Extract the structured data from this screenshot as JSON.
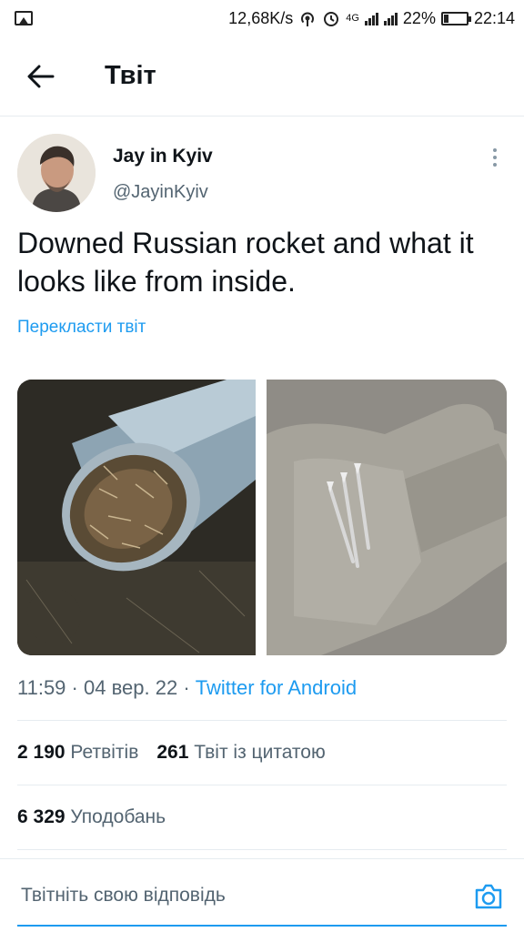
{
  "status_bar": {
    "network_speed": "12,68K/s",
    "network_type": "4G",
    "battery_percent": "22%",
    "time": "22:14",
    "icons": [
      "image-icon",
      "hotspot-icon",
      "alarm-icon",
      "signal-icon",
      "battery-icon"
    ]
  },
  "header": {
    "title": "Твіт",
    "back_icon": "arrow-left-icon"
  },
  "tweet": {
    "author_name": "Jay in Kyiv",
    "author_handle": "@JayinKyiv",
    "text": "Downed Russian rocket and what it looks like from inside.",
    "translate_label": "Перекласти твіт",
    "media": [
      {
        "description_icon": "photo-icon"
      },
      {
        "description_icon": "photo-icon"
      }
    ],
    "time": "11:59",
    "date": "04 вер. 22",
    "separator": "·",
    "client": "Twitter for Android"
  },
  "stats": {
    "retweets_count": "2 190",
    "retweets_label": "Ретвітів",
    "quotes_count": "261",
    "quotes_label": "Твіт із цитатою",
    "likes_count": "6 329",
    "likes_label": "Уподобань"
  },
  "reply": {
    "placeholder": "Твітніть свою відповідь",
    "camera_icon": "camera-icon"
  },
  "colors": {
    "accent": "#1d9bf0",
    "text_primary": "#0f1419",
    "text_secondary": "#536471",
    "divider": "#e6ecf0"
  }
}
